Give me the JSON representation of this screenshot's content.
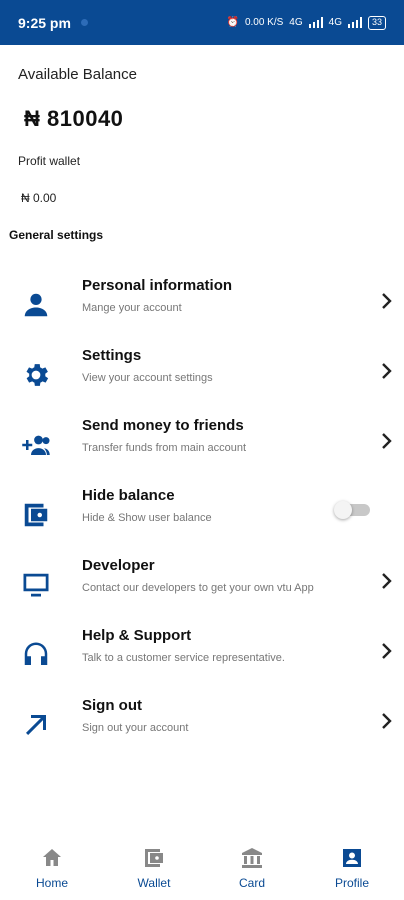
{
  "status_bar": {
    "time": "9:25 pm",
    "right_text": "0.00 K/S",
    "network_1": "4G",
    "network_2": "4G",
    "battery": "33"
  },
  "wallet": {
    "available_label": "Available Balance",
    "available_amount": "₦ 810040",
    "profit_label": "Profit wallet",
    "profit_amount": "₦ 0.00"
  },
  "section_title": "General settings",
  "menu": [
    {
      "title": "Personal information",
      "subtitle": "Mange your account",
      "icon": "person-icon"
    },
    {
      "title": "Settings",
      "subtitle": "View your account settings",
      "icon": "gear-icon"
    },
    {
      "title": "Send money to friends",
      "subtitle": "Transfer funds from main account",
      "icon": "add-people-icon"
    },
    {
      "title": "Hide balance",
      "subtitle": "Hide & Show user balance",
      "icon": "wallet-icon",
      "toggle": false
    },
    {
      "title": "Developer",
      "subtitle": "Contact our developers to get your own vtu App",
      "icon": "monitor-icon"
    },
    {
      "title": "Help & Support",
      "subtitle": "Talk to a customer service representative.",
      "icon": "headphones-icon"
    },
    {
      "title": "Sign out",
      "subtitle": "Sign out your account",
      "icon": "arrow-up-right-icon"
    }
  ],
  "bottom_nav": [
    {
      "label": "Home",
      "icon": "home-icon",
      "active": false
    },
    {
      "label": "Wallet",
      "icon": "wallet-icon",
      "active": false
    },
    {
      "label": "Card",
      "icon": "bank-icon",
      "active": false
    },
    {
      "label": "Profile",
      "icon": "profile-icon",
      "active": true
    }
  ],
  "colors": {
    "brand": "#0a4a93",
    "inactive_icon": "#888888"
  }
}
